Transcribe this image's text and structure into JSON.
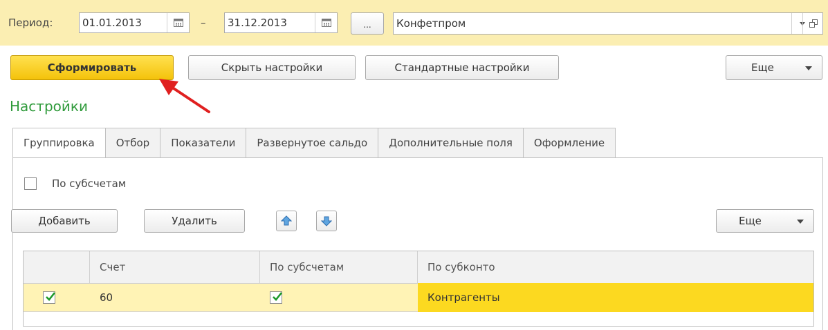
{
  "period": {
    "label": "Период:",
    "date_from": "01.01.2013",
    "dash": "–",
    "date_to": "31.12.2013",
    "more_label": "...",
    "organization": "Конфетпром"
  },
  "toolbar": {
    "generate_label": "Сформировать",
    "hide_settings_label": "Скрыть настройки",
    "standard_settings_label": "Стандартные настройки",
    "more_label": "Еще"
  },
  "settings": {
    "title": "Настройки",
    "tabs": [
      {
        "label": "Группировка"
      },
      {
        "label": "Отбор"
      },
      {
        "label": "Показатели"
      },
      {
        "label": "Развернутое сальдо"
      },
      {
        "label": "Дополнительные поля"
      },
      {
        "label": "Оформление"
      }
    ],
    "by_subaccounts_label": "По субсчетам",
    "by_subaccounts_checked": false,
    "add_label": "Добавить",
    "delete_label": "Удалить",
    "more_label": "Еще"
  },
  "table": {
    "columns": [
      "",
      "Счет",
      "По субсчетам",
      "По субконто"
    ],
    "rows": [
      {
        "checked": true,
        "account": "60",
        "by_subaccounts": true,
        "by_subconto": "Контрагенты"
      }
    ]
  },
  "colors": {
    "period_bar": "#fbeeb2",
    "primary_button": "#f4c20b",
    "selected_row": "#fff3b5",
    "selected_cell": "#fcd920",
    "settings_title": "#2e9a3a",
    "annotation_arrow": "#e02020"
  }
}
